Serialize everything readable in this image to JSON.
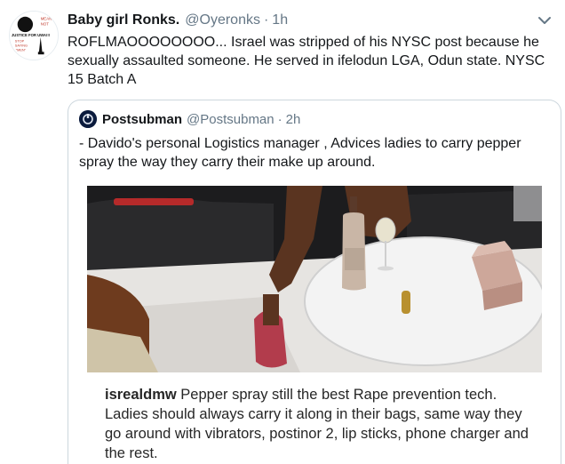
{
  "tweet": {
    "author_name": "Baby girl Ronks.",
    "author_handle": "@Oyeronks",
    "separator": "·",
    "time": "1h",
    "text": "ROFLMAOOOOOOOO... Israel was stripped of his NYSC post because he sexually assaulted someone. He served in ifelodun LGA, Odun state. NYSC 15 Batch A",
    "avatar_text": {
      "line1": "MEAN",
      "line2": "NOT",
      "line3": "JUSTICE FOR UWA!!!",
      "line4": "STOP",
      "line5": "SAYING",
      "line6": "\"MEN\""
    }
  },
  "quoted": {
    "author_name": "Postsubman",
    "author_handle": "@Postsubman",
    "separator": "·",
    "time": "2h",
    "text": "- Davido's personal Logistics manager , Advices ladies to carry pepper spray the way they carry their make up around.",
    "caption_user": "isrealdmw",
    "caption_text": " Pepper spray still the best Rape prevention tech. Ladies should always carry it along in their bags, same way they go around with vibrators, postinor 2, lip sticks, phone charger and the rest."
  },
  "colors": {
    "text_primary": "#14171a",
    "text_secondary": "#657786",
    "border": "#ccd6dd"
  },
  "icons": {
    "caret": "chevron-down-icon"
  }
}
